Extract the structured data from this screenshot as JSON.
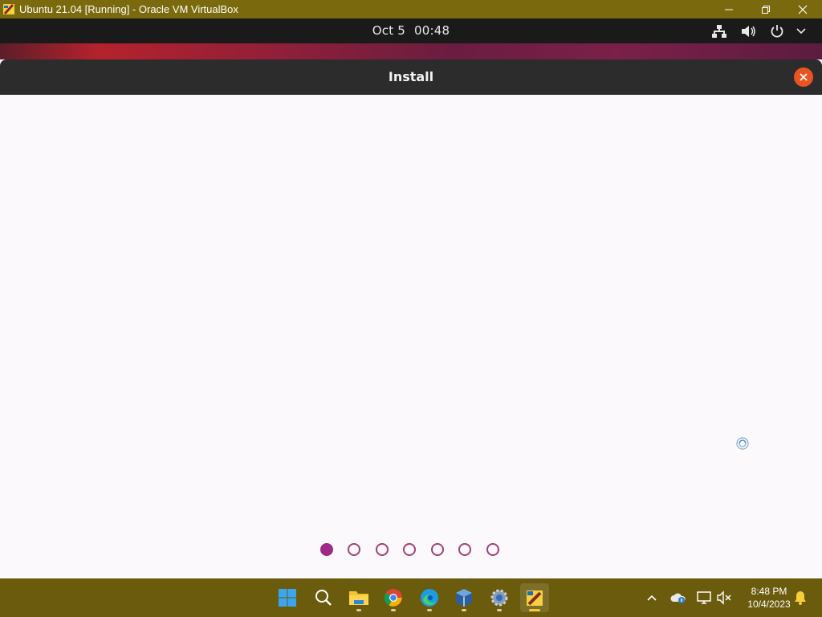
{
  "host_window": {
    "title": "Ubuntu 21.04 [Running] - Oracle VM VirtualBox"
  },
  "gnome_topbar": {
    "date": "Oct 5",
    "time": "00:48",
    "icons": [
      "network-wired-icon",
      "volume-icon",
      "power-icon",
      "chevron-down-icon"
    ]
  },
  "installer": {
    "title": "Install",
    "slideshow": {
      "total_slides": 7,
      "current_slide": 1
    },
    "colors": {
      "accent": "#9c2a86",
      "close": "#e95420"
    }
  },
  "taskbar": {
    "apps": [
      "windows-start-icon",
      "search-icon",
      "file-explorer-icon",
      "chrome-icon",
      "edge-icon",
      "virtualbox-icon",
      "settings-icon",
      "virtualbox-vm-icon"
    ],
    "tray": [
      "chevron-up-icon",
      "onedrive-icon",
      "network-icon",
      "volume-muted-icon",
      "notifications-icon"
    ],
    "clock_time": "8:48 PM",
    "clock_date": "10/4/2023"
  }
}
